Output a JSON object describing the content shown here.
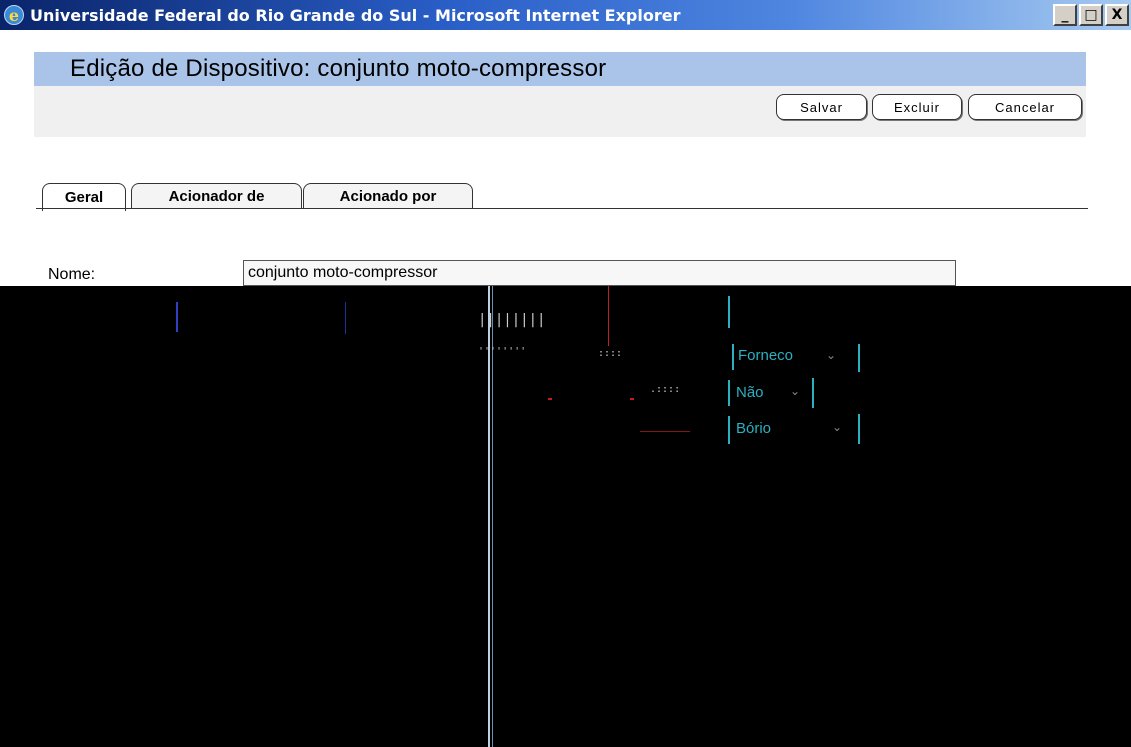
{
  "window": {
    "title": "Universidade Federal do Rio Grande do Sul - Microsoft Internet Explorer",
    "app_icon": "ie-icon",
    "controls": {
      "minimize": "_",
      "maximize": "□",
      "close": "X"
    }
  },
  "page": {
    "title": "Edição de Dispositivo: conjunto moto-compressor"
  },
  "toolbar": {
    "save_label": "Salvar",
    "delete_label": "Excluir",
    "cancel_label": "Cancelar"
  },
  "tabs": [
    {
      "label": "Geral",
      "active": true
    },
    {
      "label": "Acionador de",
      "active": false
    },
    {
      "label": "Acionado por",
      "active": false
    }
  ],
  "form": {
    "nome_label": "Nome:",
    "nome_value": "conjunto moto-compressor",
    "garbled": {
      "fragment_1": "Forneco",
      "fragment_2": "Não",
      "fragment_3": "Bório"
    }
  }
}
